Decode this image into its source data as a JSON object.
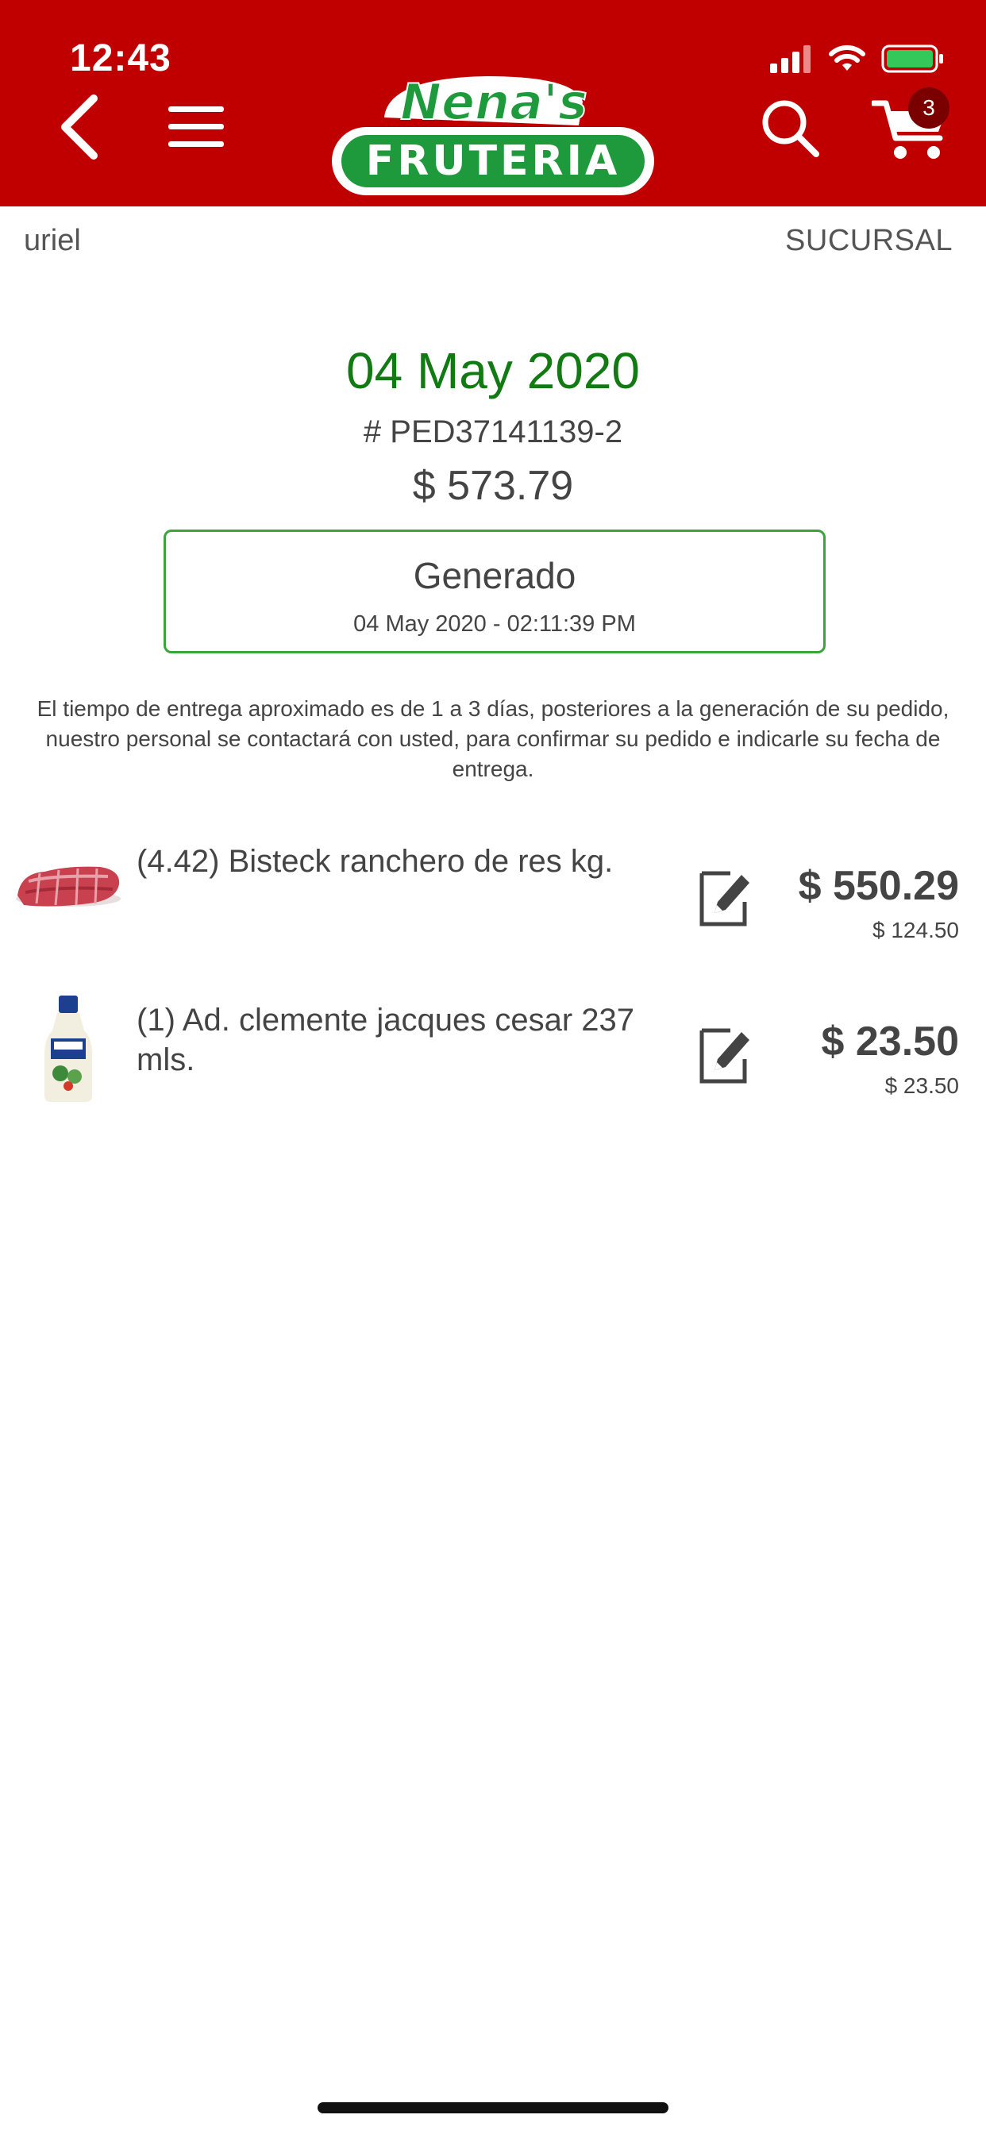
{
  "status_bar": {
    "time": "12:43"
  },
  "header": {
    "logo_top": "Nena's",
    "logo_bottom": "FRUTERIA",
    "cart_count": "3"
  },
  "user_row": {
    "username": "uriel",
    "branch": "SUCURSAL"
  },
  "order": {
    "date": "04 May 2020",
    "number": "# PED37141139-2",
    "total": "$ 573.79",
    "status": "Generado",
    "status_date": "04 May 2020 - 02:11:39 PM",
    "delivery_note": "El tiempo de entrega aproximado es de 1 a 3 días, posteriores a la generación de su pedido, nuestro personal se contactará con usted, para confirmar su pedido e indicarle su fecha de entrega."
  },
  "items": [
    {
      "name": "(4.42) Bisteck ranchero de res kg.",
      "price": "$ 550.29",
      "unit_price": "$ 124.50",
      "thumb_icon": "beef-steak-image"
    },
    {
      "name": "(1) Ad. clemente jacques cesar 237 mls.",
      "price": "$ 23.50",
      "unit_price": "$ 23.50",
      "thumb_icon": "dressing-bottle-image"
    }
  ],
  "colors": {
    "header_red": "#c00000",
    "date_green": "#127a12",
    "status_border": "#3aa53a",
    "logo_green": "#1e9a3c"
  }
}
